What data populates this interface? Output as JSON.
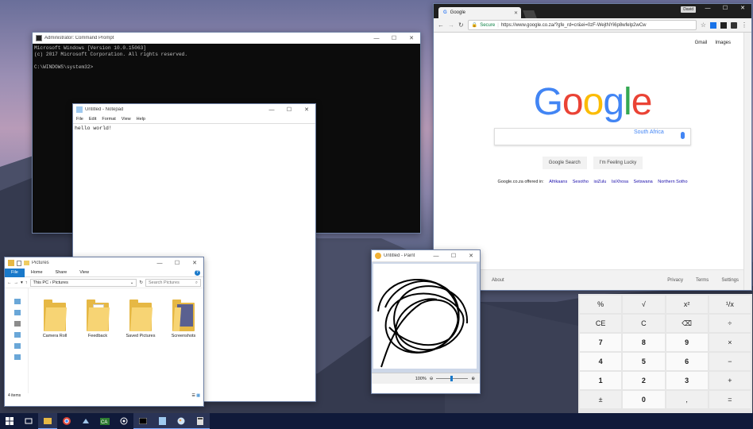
{
  "cmd": {
    "title": "Administrator: Command Prompt",
    "lines": [
      "Microsoft Windows [Version 10.0.15063]",
      "(c) 2017 Microsoft Corporation. All rights reserved.",
      "",
      "C:\\WINDOWS\\system32>"
    ]
  },
  "notepad": {
    "title": "Untitled - Notepad",
    "menu": [
      "File",
      "Edit",
      "Format",
      "View",
      "Help"
    ],
    "content": "hello world!"
  },
  "explorer": {
    "title": "Pictures",
    "ribbon": [
      "File",
      "Home",
      "Share",
      "View"
    ],
    "path": [
      "This PC",
      "Pictures"
    ],
    "search_placeholder": "Search Pictures",
    "items": [
      "Camera Roll",
      "Feedback",
      "Saved Pictures",
      "Screenshots"
    ],
    "status": "4 items"
  },
  "chrome": {
    "tab_title": "Google",
    "user": "David",
    "secure": "Secure",
    "url": "https://www.google.co.za/?gfe_rd=cr&ei=0zF-WejtNYi6p8wfelp2wCw",
    "top_links": [
      "Gmail",
      "Images"
    ],
    "logo": "Google",
    "region": "South Africa",
    "buttons": [
      "Google Search",
      "I'm Feeling Lucky"
    ],
    "offered_in": "Google.co.za offered in:",
    "languages": [
      "Afrikaans",
      "Sesotho",
      "isiZulu",
      "IsiXhosa",
      "Setswana",
      "Northern Sotho"
    ],
    "footer_left": "About",
    "footer_right": [
      "Privacy",
      "Terms",
      "Settings"
    ]
  },
  "paint": {
    "title": "Untitled - Paint",
    "zoom": "100%"
  },
  "calculator": {
    "keys": [
      "%",
      "√",
      "x²",
      "¹/x",
      "CE",
      "C",
      "⌫",
      "÷",
      "7",
      "8",
      "9",
      "×",
      "4",
      "5",
      "6",
      "−",
      "1",
      "2",
      "3",
      "+",
      "±",
      "0",
      ",",
      "="
    ]
  },
  "taskbar": {
    "icons": [
      "start-icon",
      "task-view-icon",
      "file-explorer-icon",
      "chrome-icon",
      "steam-icon",
      "terminal-icon",
      "network-icon",
      "cmd-icon",
      "notepad-icon",
      "paint-icon",
      "calculator-icon"
    ]
  }
}
